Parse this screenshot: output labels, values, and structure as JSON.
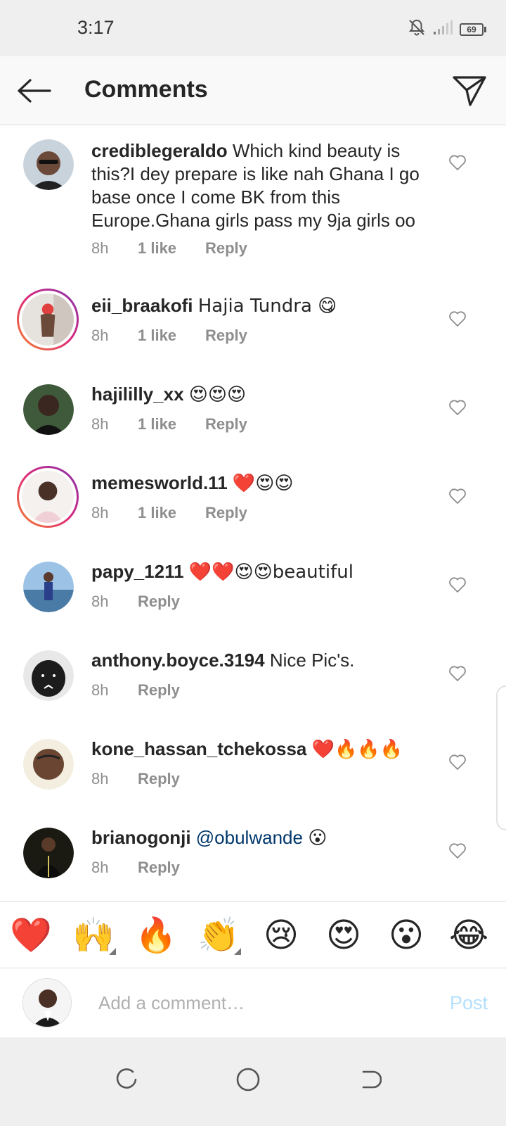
{
  "status_bar": {
    "time": "3:17",
    "battery": "69",
    "icons": [
      "bell-off-icon",
      "signal-icon",
      "battery-icon"
    ]
  },
  "header": {
    "title": "Comments",
    "back_icon": "arrow-left-icon",
    "share_icon": "paper-plane-icon"
  },
  "comments": [
    {
      "username": "crediblegeraldo",
      "text": "Which kind beauty is this?I dey prepare is like nah Ghana I go base once I come BK from this Europe.Ghana girls pass my 9ja girls oo",
      "time": "8h",
      "likes": "1 like",
      "reply": "Reply",
      "story_ring": false
    },
    {
      "username": "eii_braakofi",
      "text": "Hajia Tundra 😋",
      "time": "8h",
      "likes": "1 like",
      "reply": "Reply",
      "story_ring": true
    },
    {
      "username": "hajililly_xx",
      "text": "😍😍😍",
      "time": "8h",
      "likes": "1 like",
      "reply": "Reply",
      "story_ring": false
    },
    {
      "username": "memesworld.11",
      "text": "❤️😍😍",
      "time": "8h",
      "likes": "1 like",
      "reply": "Reply",
      "story_ring": true
    },
    {
      "username": "papy_1211",
      "text": "❤️❤️😍😍beautiful",
      "time": "8h",
      "likes": "",
      "reply": "Reply",
      "story_ring": false
    },
    {
      "username": "anthony.boyce.3194",
      "text": "Nice Pic's.",
      "time": "8h",
      "likes": "",
      "reply": "Reply",
      "story_ring": false
    },
    {
      "username": "kone_hassan_tchekossa",
      "text": "❤️🔥🔥🔥",
      "time": "8h",
      "likes": "",
      "reply": "Reply",
      "story_ring": false
    },
    {
      "username": "brianogonji",
      "mention": "@obulwande",
      "text": "😮",
      "time": "8h",
      "likes": "",
      "reply": "Reply",
      "story_ring": false
    }
  ],
  "emoji_bar": [
    "❤️",
    "🙌",
    "🔥",
    "👏",
    "😢",
    "😍",
    "😮",
    "😂"
  ],
  "comment_input": {
    "placeholder": "Add a comment…",
    "post_label": "Post"
  },
  "colors": {
    "accent_blue": "#0095f6",
    "post_disabled": "#b2dffc",
    "mention": "#00376b",
    "meta_gray": "#8e8e8e"
  }
}
